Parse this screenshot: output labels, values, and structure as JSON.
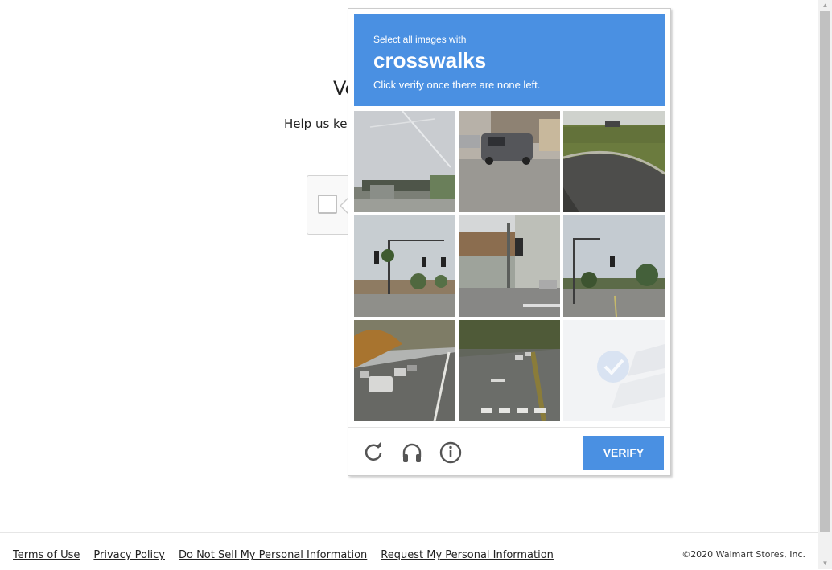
{
  "page": {
    "heading_partial": "Ve",
    "subtext_partial": "Help us kee"
  },
  "challenge": {
    "header": {
      "line1": "Select all images with",
      "keyword": "crosswalks",
      "line3": "Click verify once there are none left."
    },
    "tiles": [
      {
        "scene": "sky-overpass"
      },
      {
        "scene": "van-building"
      },
      {
        "scene": "curved-road"
      },
      {
        "scene": "traffic-light-palms"
      },
      {
        "scene": "traffic-light-building"
      },
      {
        "scene": "intersection-streetlight"
      },
      {
        "scene": "highway-cars"
      },
      {
        "scene": "road-crosswalk-markings"
      },
      {
        "scene": "selected-faded",
        "selected": true
      }
    ],
    "controls": {
      "reload_icon": "reload-icon",
      "audio_icon": "headphones-icon",
      "info_icon": "info-icon",
      "verify_label": "VERIFY"
    },
    "colors": {
      "accent": "#4a90e2"
    }
  },
  "footer": {
    "links": [
      "Terms of Use",
      "Privacy Policy",
      "Do Not Sell My Personal Information",
      "Request My Personal Information"
    ],
    "copyright": "©2020 Walmart Stores, Inc."
  }
}
